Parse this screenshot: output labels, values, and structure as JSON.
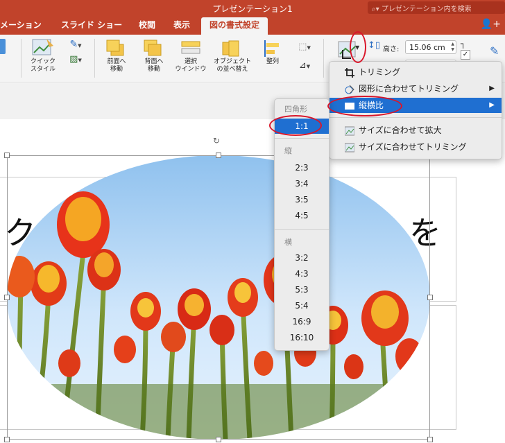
{
  "app": {
    "document_title": "プレゼンテーション1",
    "search_placeholder": "プレゼンテーション内を検索"
  },
  "tabs": [
    {
      "label": "メーション"
    },
    {
      "label": "スライド ショー"
    },
    {
      "label": "校閲"
    },
    {
      "label": "表示"
    },
    {
      "label": "図の書式設定",
      "active": true
    }
  ],
  "ribbon": {
    "quick_styles": "クイック\nスタイル",
    "bring_forward": "前面へ\n移動",
    "send_backward": "背面へ\n移動",
    "selection_pane": "選択\nウインドウ",
    "reorder_objects": "オブジェクト\nの並べ替え",
    "align": "整列",
    "height_label": "高さ:",
    "height_value": "15.06 cm"
  },
  "crop_menu": {
    "items": [
      {
        "label": "トリミング",
        "icon": "crop-icon"
      },
      {
        "label": "図形に合わせてトリミング",
        "icon": "shape-crop-icon",
        "submenu": true
      },
      {
        "label": "縦横比",
        "icon": "aspect-ratio-icon",
        "submenu": true,
        "highlighted": true
      },
      {
        "label": "サイズに合わせて拡大",
        "icon": "fill-icon"
      },
      {
        "label": "サイズに合わせてトリミング",
        "icon": "fit-icon"
      }
    ]
  },
  "aspect_menu": {
    "square_header": "四角形",
    "square": [
      "1:1"
    ],
    "portrait_header": "縦",
    "portrait": [
      "2:3",
      "3:4",
      "3:5",
      "4:5"
    ],
    "landscape_header": "横",
    "landscape": [
      "3:2",
      "4:3",
      "5:3",
      "5:4",
      "16:9",
      "16:10"
    ],
    "selected": "1:1"
  },
  "slide": {
    "text_left": "ク",
    "text_right": "を"
  },
  "colors": {
    "accent": "#c1432b",
    "highlight": "#1f6fd1",
    "annotation_ring": "#d9162a"
  }
}
